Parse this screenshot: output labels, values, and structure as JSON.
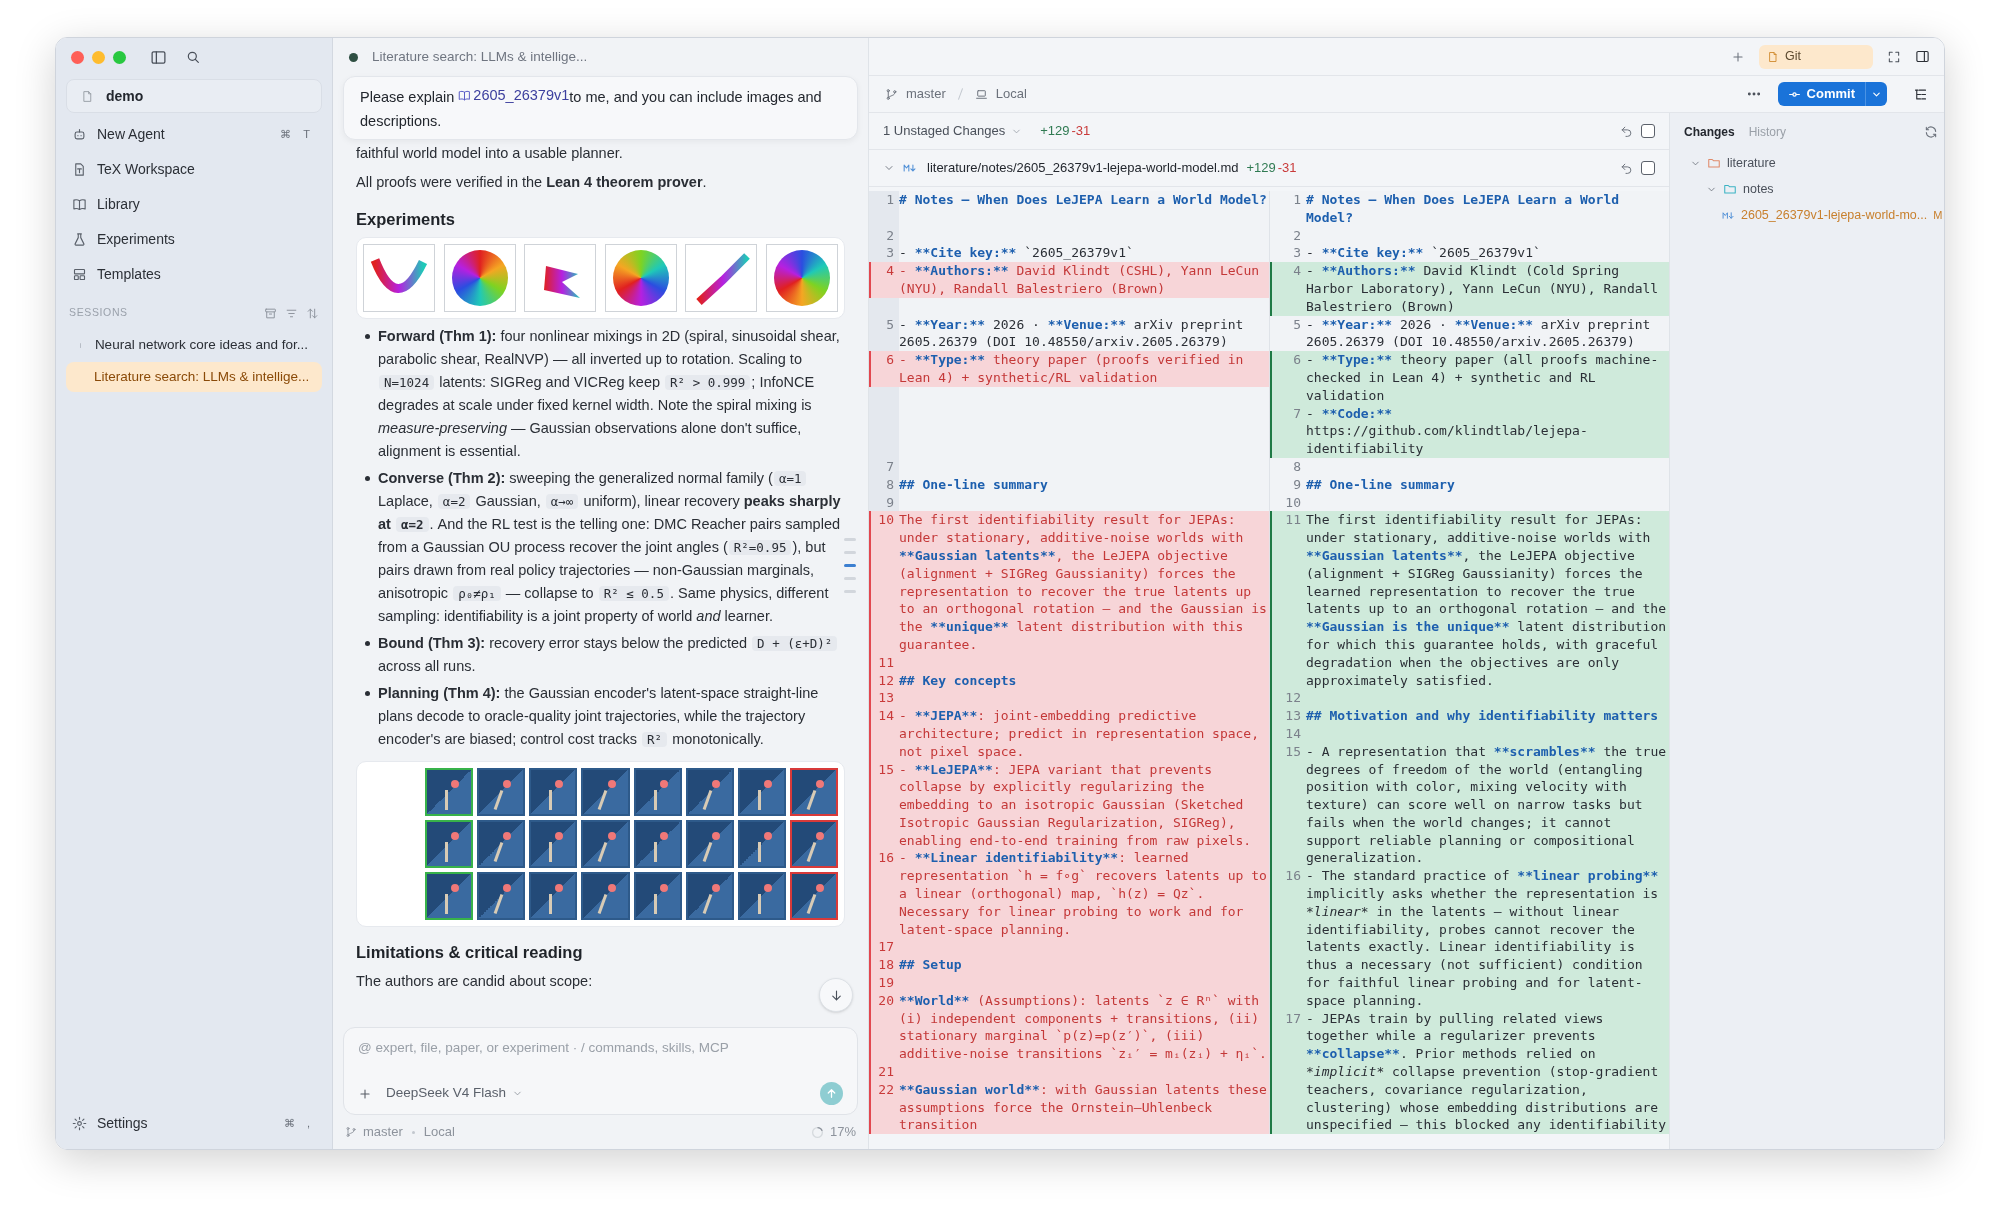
{
  "sidebar": {
    "workspace": "demo",
    "nav": [
      {
        "label": "New Agent",
        "shortcut": [
          "⌘",
          "T"
        ]
      },
      {
        "label": "TeX Workspace"
      },
      {
        "label": "Library"
      },
      {
        "label": "Experiments"
      },
      {
        "label": "Templates"
      }
    ],
    "sessions_heading": "SESSIONS",
    "sessions": [
      {
        "label": "Neural network core ideas and for...",
        "selected": false
      },
      {
        "label": "Literature search: LLMs & intellige...",
        "selected": true
      }
    ],
    "settings": {
      "label": "Settings",
      "shortcut": [
        "⌘",
        ","
      ]
    }
  },
  "chat": {
    "title": "Literature search: LLMs & intellige...",
    "prompt": {
      "before": "Please explain ",
      "link": "2605_26379v1",
      "after": "to me, and you can include images and descriptions."
    },
    "content": [
      {
        "kind": "paragraph",
        "segments": [
          {
            "kind": "text",
            "text": "faithful world model into a usable planner."
          }
        ]
      },
      {
        "kind": "paragraph",
        "segments": [
          {
            "kind": "text",
            "text": "All proofs were verified in the **Lean 4 theorem prover**."
          }
        ]
      },
      {
        "kind": "heading",
        "text": "Experiments"
      },
      {
        "kind": "scatter-figure"
      },
      {
        "kind": "bullets",
        "items": [
          {
            "segments": [
              {
                "kind": "text",
                "text": "**Forward (Thm 1):** four nonlinear mixings in 2D (spiral, sinusoidal shear, parabolic shear, RealNVP) — all inverted up to rotation. Scaling to "
              },
              {
                "kind": "code",
                "text": "N=1024"
              },
              {
                "kind": "text",
                "text": " latents: SIGReg and VICReg keep "
              },
              {
                "kind": "code",
                "text": "R² > 0.999"
              },
              {
                "kind": "text",
                "text": "; InfoNCE degrades at scale under fixed kernel width. Note the spiral mixing is *measure-preserving* — Gaussian observations alone don't suffice, alignment is essential."
              }
            ]
          },
          {
            "segments": [
              {
                "kind": "text",
                "text": "**Converse (Thm 2):** sweeping the generalized normal family ("
              },
              {
                "kind": "code",
                "text": "α=1"
              },
              {
                "kind": "text",
                "text": " Laplace, "
              },
              {
                "kind": "code",
                "text": "α=2"
              },
              {
                "kind": "text",
                "text": " Gaussian, "
              },
              {
                "kind": "code",
                "text": "α→∞"
              },
              {
                "kind": "text",
                "text": " uniform), linear recovery **peaks sharply at** "
              },
              {
                "kind": "code",
                "text": "**α=2**"
              },
              {
                "kind": "text",
                "text": ". And the RL test is the telling one: DMC Reacher pairs sampled from a Gaussian OU process recover the joint angles ("
              },
              {
                "kind": "code",
                "text": "R²=0.95"
              },
              {
                "kind": "text",
                "text": "), but pairs drawn from real policy trajectories — non-Gaussian marginals, anisotropic "
              },
              {
                "kind": "code",
                "text": "ρ₀≠ρ₁"
              },
              {
                "kind": "text",
                "text": " — collapse to "
              },
              {
                "kind": "code",
                "text": "R² ≤ 0.5"
              },
              {
                "kind": "text",
                "text": ". Same physics, different sampling: identifiability is a joint property of world *and* learner."
              }
            ]
          },
          {
            "segments": [
              {
                "kind": "text",
                "text": "**Bound (Thm 3):** recovery error stays below the predicted "
              },
              {
                "kind": "code",
                "text": "D + (ε+D)²"
              },
              {
                "kind": "text",
                "text": " across all runs."
              }
            ]
          },
          {
            "segments": [
              {
                "kind": "text",
                "text": "**Planning (Thm 4):** the Gaussian encoder's latent-space straight-line plans decode to oracle-quality joint trajectories, while the trajectory encoder's are biased; control cost tracks "
              },
              {
                "kind": "code",
                "text": "R²"
              },
              {
                "kind": "text",
                "text": " monotonically."
              }
            ]
          }
        ]
      },
      {
        "kind": "frames-figure"
      },
      {
        "kind": "heading",
        "text": "Limitations & critical reading"
      },
      {
        "kind": "paragraph",
        "segments": [
          {
            "kind": "text",
            "text": "The authors are candid about scope:"
          }
        ]
      }
    ],
    "input": {
      "placeholder": "@ expert, file, paper, or experiment · / commands, skills, MCP",
      "model": "DeepSeek V4 Flash"
    },
    "status": {
      "branch": "master",
      "location": "Local",
      "progress": "17%"
    }
  },
  "git": {
    "tabs": [
      {
        "label": "Git",
        "selected": true
      }
    ],
    "branch": "master",
    "location": "Local",
    "commit": "Commit",
    "unstaged": {
      "label": "1 Unstaged Changes",
      "added": "+129",
      "removed": "-31",
      "checked": false
    },
    "file": {
      "path": "literature/notes/2605_26379v1-lejepa-world-model.md",
      "added": "+129",
      "removed": "-31",
      "checked": false
    },
    "blocks": [
      {
        "left": [
          {
            "number": "1",
            "kind": "context",
            "segments": [
              {
                "kind": "markup",
                "text": "# Notes — When Does LeJEPA Learn a World Model?"
              }
            ]
          }
        ],
        "right": [
          {
            "number": "1",
            "kind": "context",
            "segments": [
              {
                "kind": "markup",
                "text": "# Notes — When Does LeJEPA Learn a World Model?"
              }
            ]
          }
        ]
      },
      {
        "left": [
          {
            "number": "2",
            "kind": "context"
          }
        ],
        "right": [
          {
            "number": "2",
            "kind": "context"
          }
        ]
      },
      {
        "left": [
          {
            "number": "3",
            "kind": "context",
            "segments": [
              {
                "kind": "plain",
                "text": "- "
              },
              {
                "kind": "markup",
                "text": "**Cite key:**"
              },
              {
                "kind": "plain",
                "text": " `2605_26379v1`"
              }
            ]
          }
        ],
        "right": [
          {
            "number": "3",
            "kind": "context",
            "segments": [
              {
                "kind": "plain",
                "text": "- "
              },
              {
                "kind": "markup",
                "text": "**Cite key:**"
              },
              {
                "kind": "plain",
                "text": " `2605_26379v1`"
              }
            ]
          }
        ]
      },
      {
        "left": [
          {
            "number": "4",
            "kind": "removed",
            "segments": [
              {
                "kind": "plain",
                "text": "- "
              },
              {
                "kind": "markup",
                "text": "**Authors:**"
              },
              {
                "kind": "plain",
                "text": " David Klindt (CSHL), Yann LeCun (NYU), Randall Balestriero (Brown)"
              }
            ]
          }
        ],
        "right": [
          {
            "number": "4",
            "kind": "added",
            "segments": [
              {
                "kind": "plain",
                "text": "- "
              },
              {
                "kind": "markup",
                "text": "**Authors:**"
              },
              {
                "kind": "plain",
                "text": " David Klindt (Cold Spring Harbor Laboratory), Yann LeCun (NYU), Randall Balestriero (Brown)"
              }
            ]
          }
        ]
      },
      {
        "left": [
          {
            "number": "5",
            "kind": "context",
            "segments": [
              {
                "kind": "plain",
                "text": "- "
              },
              {
                "kind": "markup",
                "text": "**Year:**"
              },
              {
                "kind": "plain",
                "text": " 2026 · "
              },
              {
                "kind": "markup",
                "text": "**Venue:**"
              },
              {
                "kind": "plain",
                "text": " arXiv preprint 2605.26379 (DOI 10.48550/arxiv.2605.26379)"
              }
            ]
          }
        ],
        "right": [
          {
            "number": "5",
            "kind": "context",
            "segments": [
              {
                "kind": "plain",
                "text": "- "
              },
              {
                "kind": "markup",
                "text": "**Year:**"
              },
              {
                "kind": "plain",
                "text": " 2026 · "
              },
              {
                "kind": "markup",
                "text": "**Venue:**"
              },
              {
                "kind": "plain",
                "text": " arXiv preprint 2605.26379 (DOI 10.48550/arxiv.2605.26379)"
              }
            ]
          }
        ]
      },
      {
        "left": [
          {
            "number": "6",
            "kind": "removed",
            "segments": [
              {
                "kind": "plain",
                "text": "- "
              },
              {
                "kind": "markup",
                "text": "**Type:**"
              },
              {
                "kind": "plain",
                "text": " theory paper (proofs verified in Lean 4) + synthetic/RL validation"
              }
            ]
          }
        ],
        "right": [
          {
            "number": "6",
            "kind": "added",
            "segments": [
              {
                "kind": "plain",
                "text": "- "
              },
              {
                "kind": "markup",
                "text": "**Type:**"
              },
              {
                "kind": "plain",
                "text": " theory paper (all proofs machine-checked in Lean 4) + synthetic and RL validation"
              }
            ]
          },
          {
            "number": "7",
            "kind": "added",
            "segments": [
              {
                "kind": "plain",
                "text": "- "
              },
              {
                "kind": "markup",
                "text": "**Code:**"
              },
              {
                "kind": "plain",
                "text": " https://github.com/klindtlab/lejepa-identifiability"
              }
            ]
          }
        ]
      },
      {
        "left": [
          {
            "number": "7",
            "kind": "context"
          }
        ],
        "right": [
          {
            "number": "8",
            "kind": "context"
          }
        ]
      },
      {
        "left": [
          {
            "number": "8",
            "kind": "context",
            "segments": [
              {
                "kind": "markup",
                "text": "## One-line summary"
              }
            ]
          }
        ],
        "right": [
          {
            "number": "9",
            "kind": "context",
            "segments": [
              {
                "kind": "markup",
                "text": "## One-line summary"
              }
            ]
          }
        ]
      },
      {
        "left": [
          {
            "number": "9",
            "kind": "context"
          }
        ],
        "right": [
          {
            "number": "10",
            "kind": "context"
          }
        ]
      },
      {
        "left": [
          {
            "number": "10",
            "kind": "removed",
            "segments": [
              {
                "kind": "plain",
                "text": "The first identifiability result for JEPAs: under stationary, additive-noise worlds with "
              },
              {
                "kind": "markup",
                "text": "**Gaussian latents**"
              },
              {
                "kind": "plain",
                "text": ", the LeJEPA objective (alignment + SIGReg Gaussianity) forces the representation to recover the true latents up to an orthogonal rotation — and the Gaussian is the "
              },
              {
                "kind": "markup",
                "text": "**unique**"
              },
              {
                "kind": "plain",
                "text": " latent distribution with this guarantee."
              }
            ]
          },
          {
            "number": "11",
            "kind": "removed"
          },
          {
            "number": "12",
            "kind": "removed",
            "segments": [
              {
                "kind": "markup",
                "text": "## Key concepts"
              }
            ]
          },
          {
            "number": "13",
            "kind": "removed"
          },
          {
            "number": "14",
            "kind": "removed",
            "segments": [
              {
                "kind": "plain",
                "text": "- "
              },
              {
                "kind": "markup",
                "text": "**JEPA**"
              },
              {
                "kind": "plain",
                "text": ": joint-embedding predictive architecture; predict in representation space, not pixel space."
              }
            ]
          },
          {
            "number": "15",
            "kind": "removed",
            "segments": [
              {
                "kind": "plain",
                "text": "- "
              },
              {
                "kind": "markup",
                "text": "**LeJEPA**"
              },
              {
                "kind": "plain",
                "text": ": JEPA variant that prevents collapse by explicitly regularizing the embedding to an isotropic Gaussian (Sketched Isotropic Gaussian Regularization, SIGReg), enabling end-to-end training from raw pixels."
              }
            ]
          },
          {
            "number": "16",
            "kind": "removed",
            "segments": [
              {
                "kind": "plain",
                "text": "- "
              },
              {
                "kind": "markup",
                "text": "**Linear identifiability**"
              },
              {
                "kind": "plain",
                "text": ": learned representation `h = f∘g` recovers latents up to a linear (orthogonal) map, `h(z) = Qz`. Necessary for linear probing to work and for latent-space planning."
              }
            ]
          },
          {
            "number": "17",
            "kind": "removed"
          },
          {
            "number": "18",
            "kind": "removed",
            "segments": [
              {
                "kind": "markup",
                "text": "## Setup"
              }
            ]
          },
          {
            "number": "19",
            "kind": "removed"
          },
          {
            "number": "20",
            "kind": "removed",
            "segments": [
              {
                "kind": "markup",
                "text": "**World**"
              },
              {
                "kind": "plain",
                "text": " (Assumptions): latents `z ∈ Rⁿ` with (i) independent components + transitions, (ii) stationary marginal `p(z)=p(z′)`, (iii) additive-noise transitions `zᵢ′ = mᵢ(zᵢ) + ηᵢ`."
              }
            ]
          },
          {
            "number": "21",
            "kind": "removed"
          },
          {
            "number": "22",
            "kind": "removed",
            "segments": [
              {
                "kind": "markup",
                "text": "**Gaussian world**"
              },
              {
                "kind": "plain",
                "text": ": with Gaussian latents these assumptions force the Ornstein–Uhlenbeck transition"
              }
            ]
          }
        ],
        "right": [
          {
            "number": "11",
            "kind": "added",
            "segments": [
              {
                "kind": "plain",
                "text": "The first identifiability result for JEPAs: under stationary, additive-noise worlds with "
              },
              {
                "kind": "markup",
                "text": "**Gaussian latents**"
              },
              {
                "kind": "plain",
                "text": ", the LeJEPA objective (alignment + SIGReg Gaussianity) forces the learned representation to recover the true latents up to an orthogonal rotation — and the "
              },
              {
                "kind": "markup",
                "text": "**Gaussian is the unique**"
              },
              {
                "kind": "plain",
                "text": " latent distribution for which this guarantee holds, with graceful degradation when the objectives are only approximately satisfied."
              }
            ]
          },
          {
            "number": "12",
            "kind": "added"
          },
          {
            "number": "13",
            "kind": "added",
            "segments": [
              {
                "kind": "markup",
                "text": "## Motivation and why identifiability matters"
              }
            ]
          },
          {
            "number": "14",
            "kind": "added"
          },
          {
            "number": "15",
            "kind": "added",
            "segments": [
              {
                "kind": "plain",
                "text": "- A representation that "
              },
              {
                "kind": "markup",
                "text": "**scrambles**"
              },
              {
                "kind": "plain",
                "text": " the true degrees of freedom of the world (entangling position with color, mixing velocity with texture) can score well on narrow tasks but fails when the world changes; it cannot support reliable planning or compositional generalization."
              }
            ]
          },
          {
            "number": "16",
            "kind": "added",
            "segments": [
              {
                "kind": "plain",
                "text": "- The standard practice of "
              },
              {
                "kind": "markup",
                "text": "**linear probing**"
              },
              {
                "kind": "plain",
                "text": " implicitly asks whether the representation is "
              },
              {
                "kind": "emphasis",
                "text": "*linear*"
              },
              {
                "kind": "plain",
                "text": " in the latents — without linear identifiability, probes cannot recover the latents exactly. Linear identifiability is thus a necessary (not sufficient) condition for faithful linear probing and for latent-space planning."
              }
            ]
          },
          {
            "number": "17",
            "kind": "added",
            "segments": [
              {
                "kind": "plain",
                "text": "- JEPAs train by pulling related views together while a regularizer prevents "
              },
              {
                "kind": "markup",
                "text": "**collapse**"
              },
              {
                "kind": "plain",
                "text": ". Prior methods relied on "
              },
              {
                "kind": "emphasis",
                "text": "*implicit*"
              },
              {
                "kind": "plain",
                "text": " collapse prevention (stop-gradient teachers, covariance regularization, clustering) whose embedding distributions are unspecified — this blocked any identifiability"
              }
            ]
          }
        ]
      }
    ],
    "changes_panel": {
      "tabs": [
        {
          "label": "Changes",
          "selected": true
        },
        {
          "label": "History",
          "selected": false
        }
      ],
      "tree": [
        {
          "kind": "folder",
          "label": "literature",
          "expanded": true,
          "children": [
            {
              "kind": "folder",
              "label": "notes",
              "expanded": true,
              "children": [
                {
                  "kind": "file",
                  "label": "2605_26379v1-lejepa-world-mo...",
                  "status": "M"
                }
              ]
            }
          ]
        }
      ]
    }
  }
}
